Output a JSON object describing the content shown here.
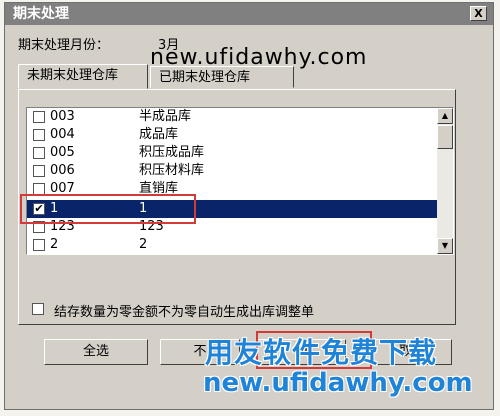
{
  "window": {
    "title": "期末处理",
    "close_label": "X"
  },
  "month": {
    "label": "期末处理月份：",
    "value": "3月"
  },
  "watermark_top": "new.ufidawhy.com",
  "tabs": [
    {
      "label": "未期末处理仓库",
      "active": true
    },
    {
      "label": "已期末处理仓库",
      "active": false
    }
  ],
  "warehouses": [
    {
      "code": "003",
      "name": "半成品库",
      "checked": false,
      "selected": false
    },
    {
      "code": "004",
      "name": "成品库",
      "checked": false,
      "selected": false
    },
    {
      "code": "005",
      "name": "积压成品库",
      "checked": false,
      "selected": false
    },
    {
      "code": "006",
      "name": "积压材料库",
      "checked": false,
      "selected": false
    },
    {
      "code": "007",
      "name": "直销库",
      "checked": false,
      "selected": false
    },
    {
      "code": "1",
      "name": "1",
      "checked": true,
      "selected": true
    },
    {
      "code": "123",
      "name": "123",
      "checked": false,
      "selected": false
    },
    {
      "code": "2",
      "name": "2",
      "checked": false,
      "selected": false
    }
  ],
  "auto_generate": {
    "label": "结存数量为零金额不为零自动生成出库调整单",
    "checked": false
  },
  "buttons": {
    "select_all": "全选",
    "deselect": "不",
    "confirm": "确",
    "cancel": "取消"
  },
  "watermark_bottom_cn": "用友软件免费下载",
  "watermark_bottom_url": "new.ufidawhy.com",
  "colors": {
    "selection": "#0a246a",
    "highlight": "#d33b3b",
    "watermark": "#1f84d8"
  }
}
